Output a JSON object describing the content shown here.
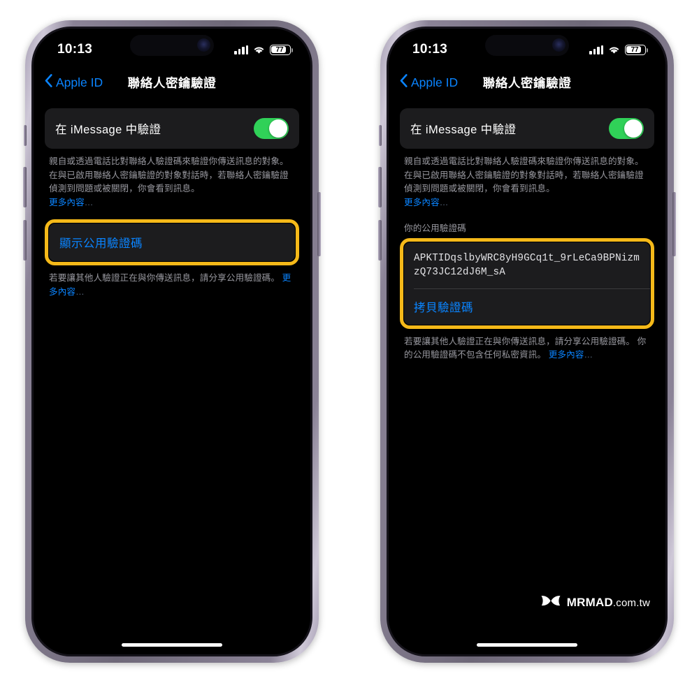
{
  "status_bar": {
    "time": "10:13",
    "battery_percent": "77",
    "signal_icon": "cellular-bars-icon",
    "wifi_icon": "wifi-icon",
    "battery_icon": "battery-icon"
  },
  "nav": {
    "back_label": "Apple ID",
    "back_icon": "chevron-left-icon",
    "title": "聯絡人密鑰驗證"
  },
  "toggle_row": {
    "label": "在 iMessage 中驗證",
    "state": "on",
    "accent_color": "#30d158"
  },
  "description": {
    "body": "親自或透過電話比對聯絡人驗證碼來驗證你傳送訊息的對象。在與已啟用聯絡人密鑰驗證的對象對話時，若聯絡人密鑰驗證偵測到問題或被關閉，你會看到訊息。",
    "link": "更多內容",
    "ellipsis": "…"
  },
  "left_phone": {
    "show_code_button": "顯示公用驗證碼",
    "footnote_body": "若要讓其他人驗證正在與你傳送訊息，請分享公用驗證碼。 ",
    "footnote_link": "更多內容",
    "footnote_ellipsis": "…"
  },
  "right_phone": {
    "group_header": "你的公用驗證碼",
    "code": "APKTIDqslbyWRC8yH9GCq1t_9rLeCa9BPNizmzQ73JC12dJ6M_sA",
    "copy_button": "拷貝驗證碼",
    "footnote_body": "若要讓其他人驗證正在與你傳送訊息，請分享公用驗證碼。 你的公用驗證碼不包含任何私密資訊。 ",
    "footnote_link": "更多內容",
    "footnote_ellipsis": "…"
  },
  "watermark": {
    "logo_icon": "mrmad-butterfly-logo-icon",
    "brand": "MRMAD",
    "tld": ".com.tw"
  },
  "highlight": {
    "color": "#f5b919"
  }
}
